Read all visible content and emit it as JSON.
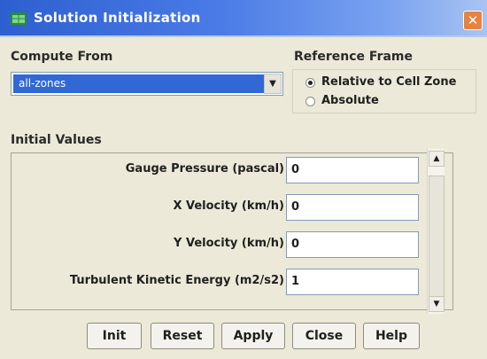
{
  "window": {
    "title": "Solution Initialization",
    "close_glyph": "✕"
  },
  "compute_from": {
    "label": "Compute From",
    "selected": "all-zones",
    "arrow": "▼"
  },
  "reference_frame": {
    "label": "Reference Frame",
    "options": [
      {
        "label": "Relative to Cell Zone",
        "selected": true
      },
      {
        "label": "Absolute",
        "selected": false
      }
    ]
  },
  "initial_values": {
    "label": "Initial Values",
    "fields": [
      {
        "label": "Gauge Pressure (pascal)",
        "value": "0"
      },
      {
        "label": "X Velocity (km/h)",
        "value": "0"
      },
      {
        "label": "Y Velocity (km/h)",
        "value": "0"
      },
      {
        "label": "Turbulent Kinetic Energy (m2/s2)",
        "value": "1"
      }
    ],
    "scroll_up": "▲",
    "scroll_down": "▼"
  },
  "buttons": {
    "init": "Init",
    "reset": "Reset",
    "apply": "Apply",
    "close": "Close",
    "help": "Help"
  },
  "icons": {
    "app": "mesh-window-icon",
    "close": "close-icon"
  },
  "colors": {
    "titlebar_start": "#2d5fd0",
    "titlebar_end": "#a9c4f2",
    "close": "#e8823f",
    "selection": "#3168d5",
    "dialog_bg": "#ece9d8"
  }
}
